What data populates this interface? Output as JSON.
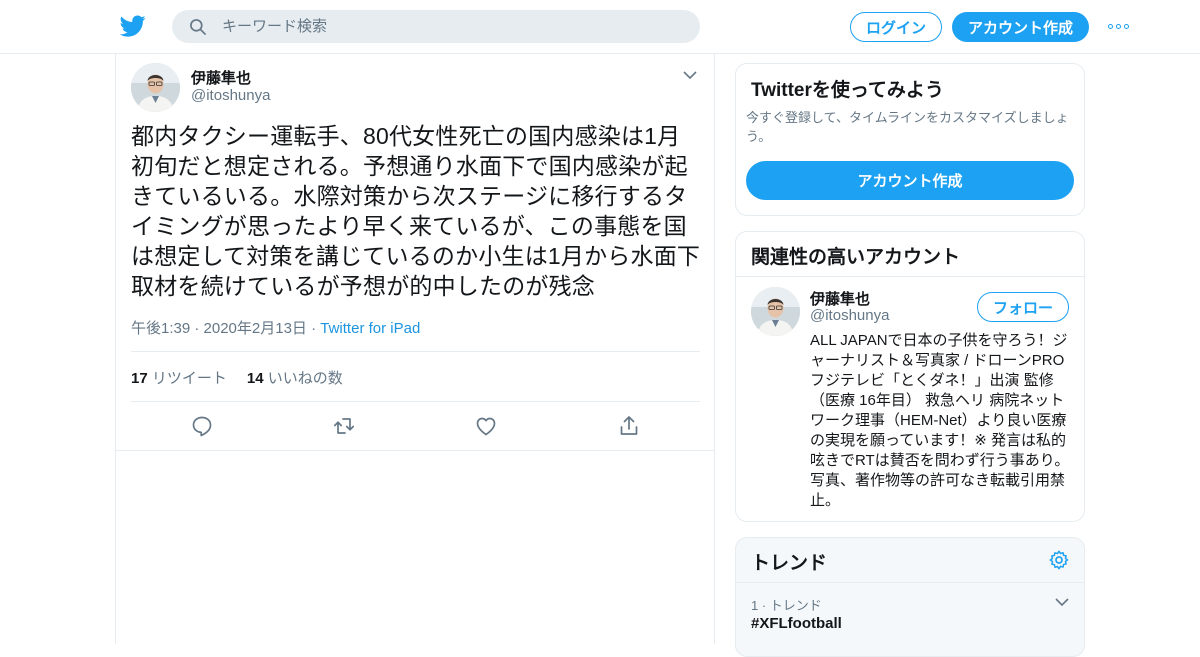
{
  "header": {
    "logo_icon": "twitter-bird-icon",
    "search_placeholder": "キーワード検索",
    "login_label": "ログイン",
    "signup_label": "アカウント作成",
    "more_icon": "more-dots-icon",
    "brand_color": "#1da1f2"
  },
  "tweet": {
    "author_name": "伊藤隼也",
    "author_handle": "@itoshunya",
    "text": "都内タクシー運転手、80代女性死亡の国内感染は1月初旬だと想定される。予想通り水面下で国内感染が起きているいる。水際対策から次ステージに移行するタイミングが思ったより早く来ているが、この事態を国は想定して対策を講じているのか小生は1月から水面下取材を続けているが予想が的中したのが残念",
    "timestamp": "午後1:39 · 2020年2月13日",
    "meta_separator": " · ",
    "source": "Twitter for iPad",
    "retweet_count": "17",
    "retweet_label": "リツイート",
    "like_count": "14",
    "like_label": "いいねの数",
    "action_icons": [
      "reply-icon",
      "retweet-icon",
      "like-icon",
      "share-icon"
    ]
  },
  "sidebar": {
    "signup_card": {
      "title": "Twitterを使ってみよう",
      "description": "今すぐ登録して、タイムラインをカスタマイズしましょう。",
      "button_label": "アカウント作成"
    },
    "related_card": {
      "title": "関連性の高いアカウント",
      "account_name": "伊藤隼也",
      "account_handle": "@itoshunya",
      "follow_label": "フォロー",
      "bio": "ALL JAPANで日本の子供を守ろう！ジャーナリスト＆写真家 / ドローンPRO フジテレビ「とくダネ！」出演 監修（医療 16年目） 救急ヘリ 病院ネットワーク理事（HEM-Net）より良い医療の実現を願っています！※ 発言は私的呟きでRTは賛否を問わず行う事あり。写真、著作物等の許可なき転載引用禁止。"
    },
    "trends_card": {
      "title": "トレンド",
      "settings_icon": "gear-icon",
      "trend_meta": "1 · トレンド",
      "trend_name": "#XFLfootball"
    }
  }
}
